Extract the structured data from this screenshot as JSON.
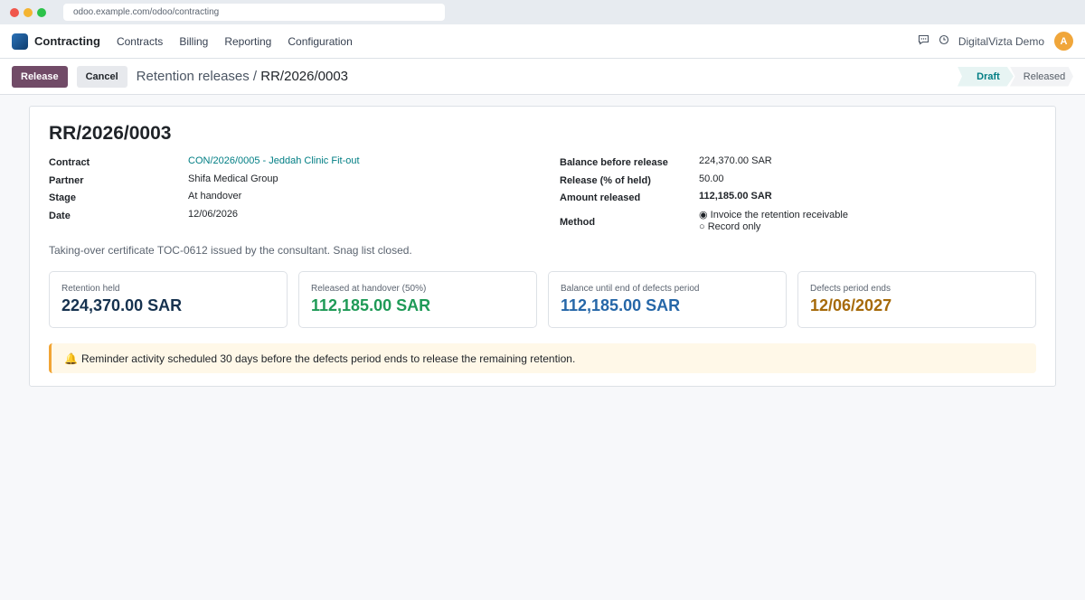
{
  "browser": {
    "url": "odoo.example.com/odoo/contracting"
  },
  "navbar": {
    "app_name": "Contracting",
    "menu": [
      "Contracts",
      "Billing",
      "Reporting",
      "Configuration"
    ],
    "user_name": "DigitalVizta Demo",
    "avatar_letter": "A",
    "icons": [
      "chat-icon",
      "clock-icon"
    ]
  },
  "control": {
    "release_label": "Release",
    "cancel_label": "Cancel",
    "breadcrumb_parent": "Retention releases",
    "breadcrumb_separator": "/",
    "breadcrumb_current": "RR/2026/0003",
    "stages": [
      {
        "label": "Draft",
        "active": true
      },
      {
        "label": "Released",
        "active": false
      }
    ]
  },
  "record": {
    "title": "RR/2026/0003",
    "left_fields": [
      {
        "label": "Contract",
        "value": "CON/2026/0005 - Jeddah Clinic Fit-out"
      },
      {
        "label": "Partner",
        "value": "Shifa Medical Group"
      },
      {
        "label": "Stage",
        "value": "At handover"
      },
      {
        "label": "Date",
        "value": "12/06/2026"
      }
    ],
    "right_fields": [
      {
        "label": "Balance before release",
        "value": "224,370.00 SAR"
      },
      {
        "label": "Release (% of held)",
        "value": "50.00"
      },
      {
        "label": "Amount released",
        "value": "112,185.00 SAR"
      }
    ],
    "method": {
      "label": "Method",
      "options": [
        {
          "symbol": "◉",
          "label": "Invoice the retention receivable",
          "selected": true
        },
        {
          "symbol": "○",
          "label": "Record only",
          "selected": false
        }
      ]
    },
    "note": "Taking-over certificate TOC-0612 issued by the consultant. Snag list closed.",
    "cards": [
      {
        "label": "Retention held",
        "value": "224,370.00 SAR",
        "color": "#16324f"
      },
      {
        "label": "Released at handover (50%)",
        "value": "112,185.00 SAR",
        "color": "#1f9a57"
      },
      {
        "label": "Balance until end of defects period",
        "value": "112,185.00 SAR",
        "color": "#2667a8"
      },
      {
        "label": "Defects period ends",
        "value": "12/06/2027",
        "color": "#a66a0a"
      }
    ],
    "alert": {
      "icon": "bell-icon",
      "text": "Reminder activity scheduled 30 days before the defects period ends to release the remaining retention."
    }
  }
}
